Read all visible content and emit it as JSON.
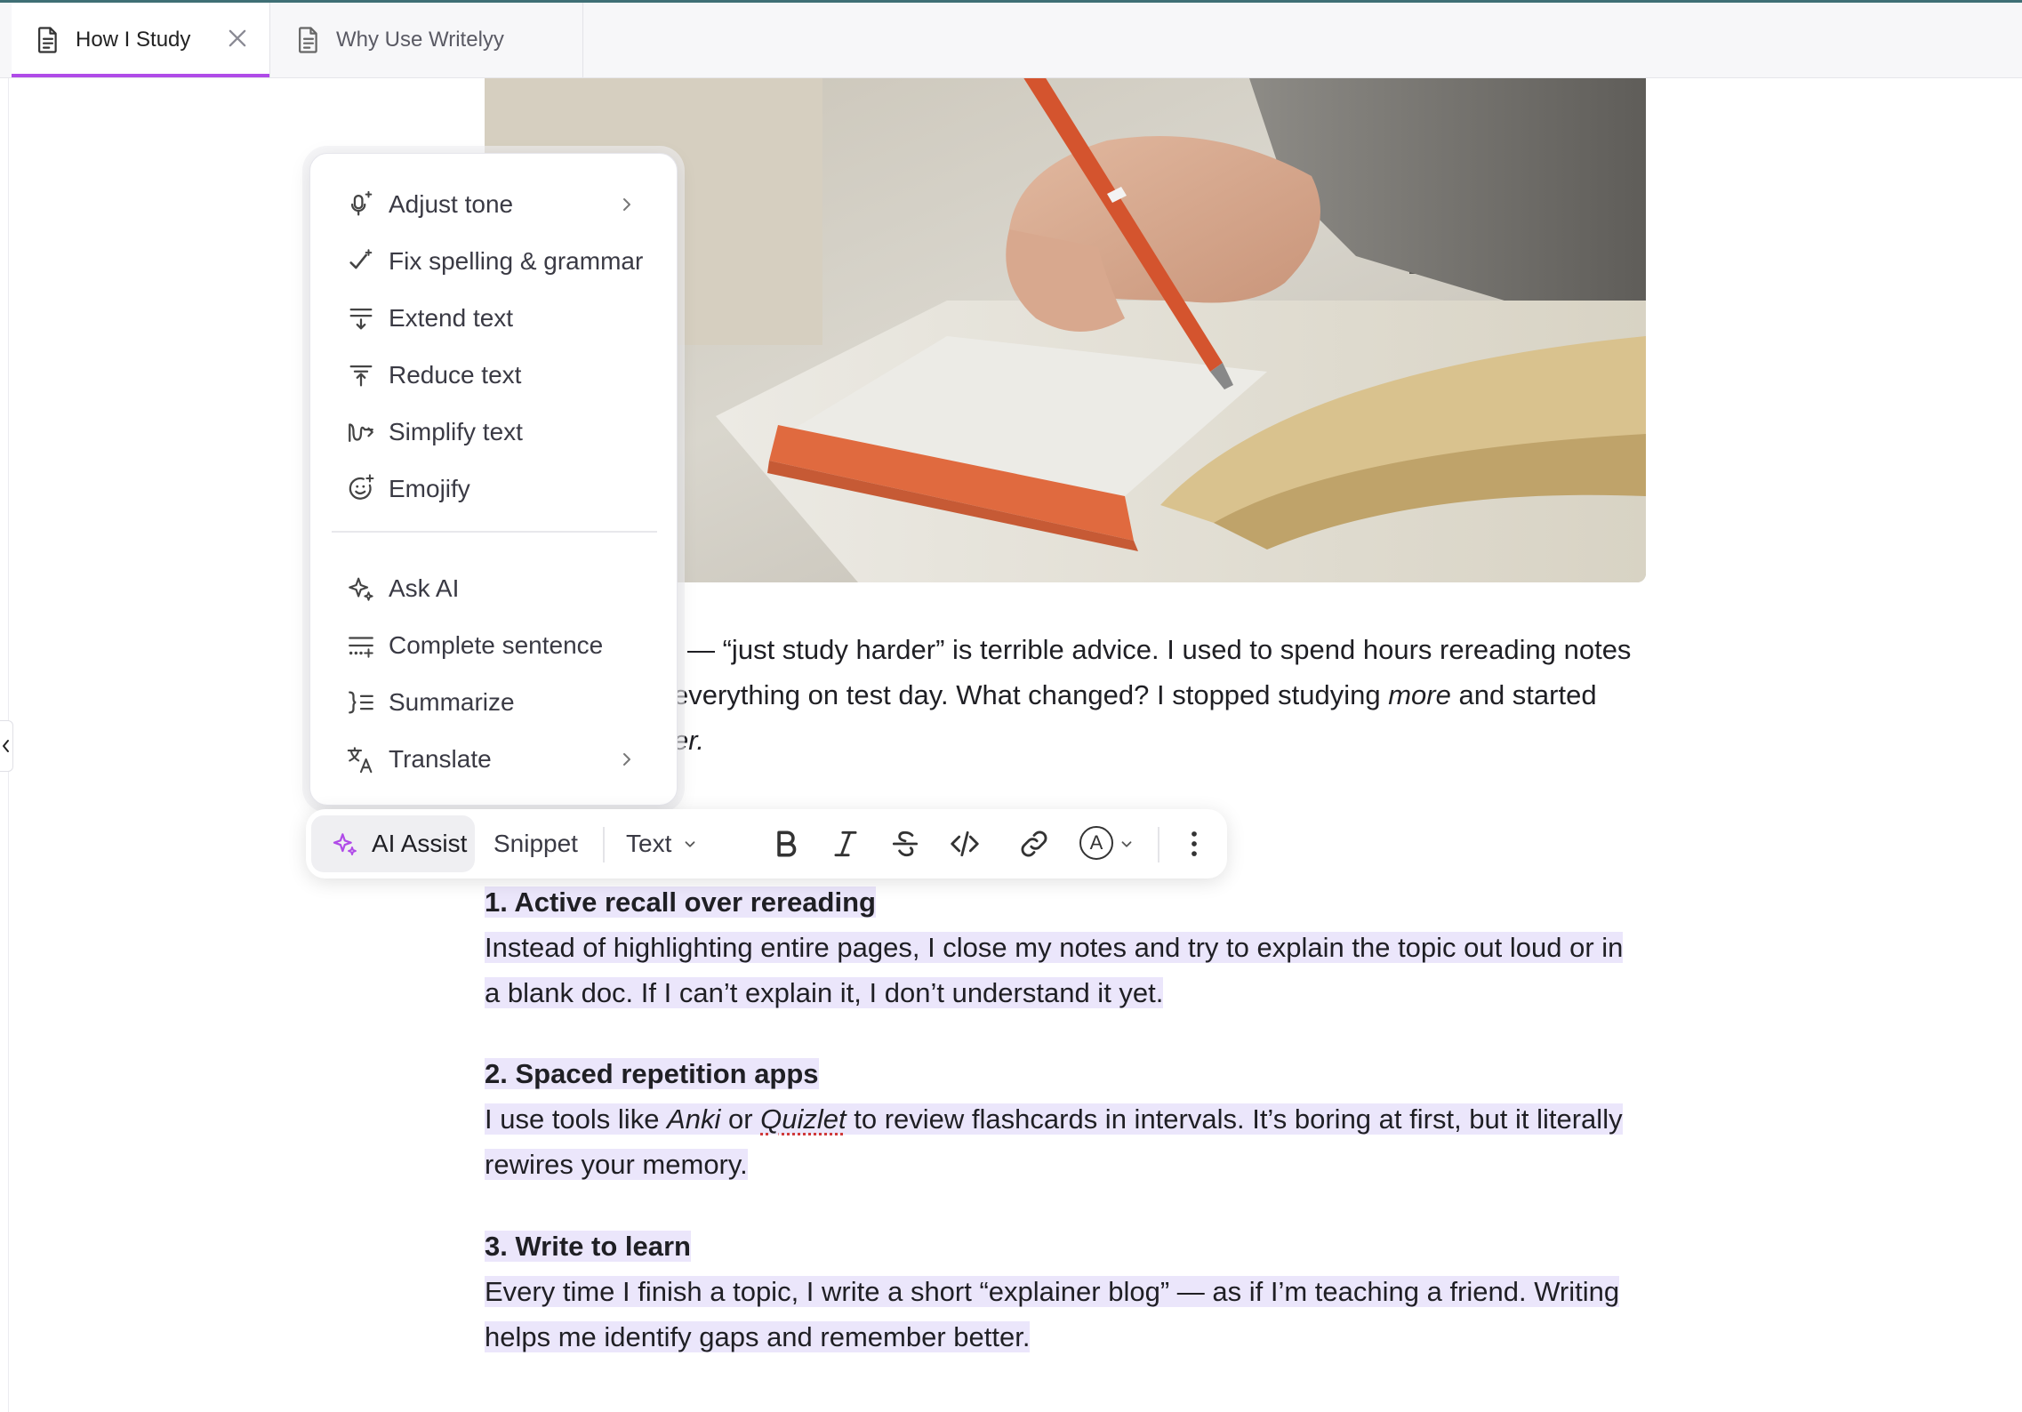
{
  "tabs": [
    {
      "label": "How I Study",
      "active": true
    },
    {
      "label": "Why Use Writelyy",
      "active": false
    }
  ],
  "accent_color": "#b04be8",
  "highlight_color": "#ebe6fb",
  "ai_menu": {
    "group1": [
      {
        "label": "Adjust tone",
        "icon": "mic-sparkle-icon",
        "submenu": true
      },
      {
        "label": "Fix spelling & grammar",
        "icon": "check-sparkle-icon",
        "submenu": false
      },
      {
        "label": "Extend text",
        "icon": "extend-lines-icon",
        "submenu": false
      },
      {
        "label": "Reduce text",
        "icon": "reduce-lines-icon",
        "submenu": false
      },
      {
        "label": "Simplify text",
        "icon": "simplify-wave-icon",
        "submenu": false
      },
      {
        "label": "Emojify",
        "icon": "smile-sparkle-icon",
        "submenu": false
      }
    ],
    "group2": [
      {
        "label": "Ask AI",
        "icon": "sparkles-icon",
        "submenu": false
      },
      {
        "label": "Complete sentence",
        "icon": "complete-lines-icon",
        "submenu": false
      },
      {
        "label": "Summarize",
        "icon": "summarize-list-icon",
        "submenu": false
      },
      {
        "label": "Translate",
        "icon": "translate-icon",
        "submenu": true
      }
    ]
  },
  "toolbar": {
    "ai_assist": "AI Assist",
    "snippet": "Snippet",
    "text_style": "Text",
    "tools": [
      "bold-icon",
      "italic-icon",
      "strikethrough-icon",
      "code-icon",
      "link-icon",
      "text-color-icon",
      "more-options-icon"
    ],
    "text_color_letter": "A"
  },
  "doc": {
    "intro_line1": "— “just study harder” is terrible advice. I used to spend hours rereading notes",
    "intro_line2a": "everything on test day. What changed? I stopped studying ",
    "intro_line2_em": "more",
    "intro_line2b": " and started",
    "intro_line3": "er.",
    "sections": [
      {
        "heading": "1. Active recall over rereading",
        "line1": "Instead of highlighting entire pages, I close my notes and try to explain the topic out loud or in",
        "line2": "a blank doc. If I can’t explain it, I don’t understand it yet."
      },
      {
        "heading": "2. Spaced repetition apps",
        "line1_a": "I use tools like ",
        "line1_anki": "Anki",
        "line1_or": " or ",
        "line1_quizlet": "Quizlet",
        "line1_b": " to review flashcards in intervals. It’s boring at first, but it literally",
        "line2": "rewires your memory."
      },
      {
        "heading": "3. Write to learn",
        "line1": "Every time I finish a topic, I write a short “explainer blog” — as if I’m teaching a friend. Writing",
        "line2": "helps me identify gaps and remember better."
      }
    ]
  }
}
